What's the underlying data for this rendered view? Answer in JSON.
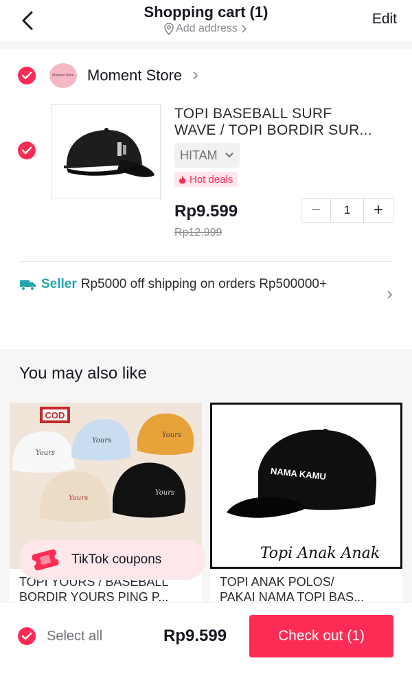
{
  "header": {
    "title": "Shopping cart (1)",
    "address_label": "Add address",
    "edit_label": "Edit"
  },
  "store": {
    "name": "Moment Store",
    "logo_text": "Moment Store"
  },
  "cart_item": {
    "title_line1": "TOPI BASEBALL SURF",
    "title_line2": "WAVE / TOPI BORDIR SUR...",
    "variant": "HITAM",
    "badge": "Hot deals",
    "price": "Rp9.599",
    "original_price": "Rp12.999",
    "quantity": "1",
    "minus_label": "−",
    "plus_label": "+"
  },
  "shipping": {
    "seller_label": "Seller",
    "text": "Rp5000 off shipping on orders Rp500000+"
  },
  "recommendations": {
    "title": "You may also like",
    "items": [
      {
        "line1": "TOPI YOURS / BASEBALL",
        "line2": "BORDIR YOURS PING P...",
        "cod_label": "COD"
      },
      {
        "line1": "TOPI ANAK POLOS/",
        "line2": "PAKAI NAMA TOPI BAS...",
        "cap_text": "NAMA KAMU",
        "script_text": "Topi Anak Anak"
      }
    ],
    "coupon_label": "TikTok coupons"
  },
  "bottom_bar": {
    "select_all_label": "Select all",
    "total": "Rp9.599",
    "checkout_label": "Check out (1)"
  },
  "colors": {
    "accent": "#fe2c55",
    "teal": "#21a5ac",
    "background_gray": "#f6f6f6"
  },
  "icons": [
    "back-arrow-icon",
    "location-pin-icon",
    "chevron-right-icon",
    "checkmark-icon",
    "chevron-down-icon",
    "fire-icon",
    "truck-icon",
    "coupon-icon"
  ]
}
